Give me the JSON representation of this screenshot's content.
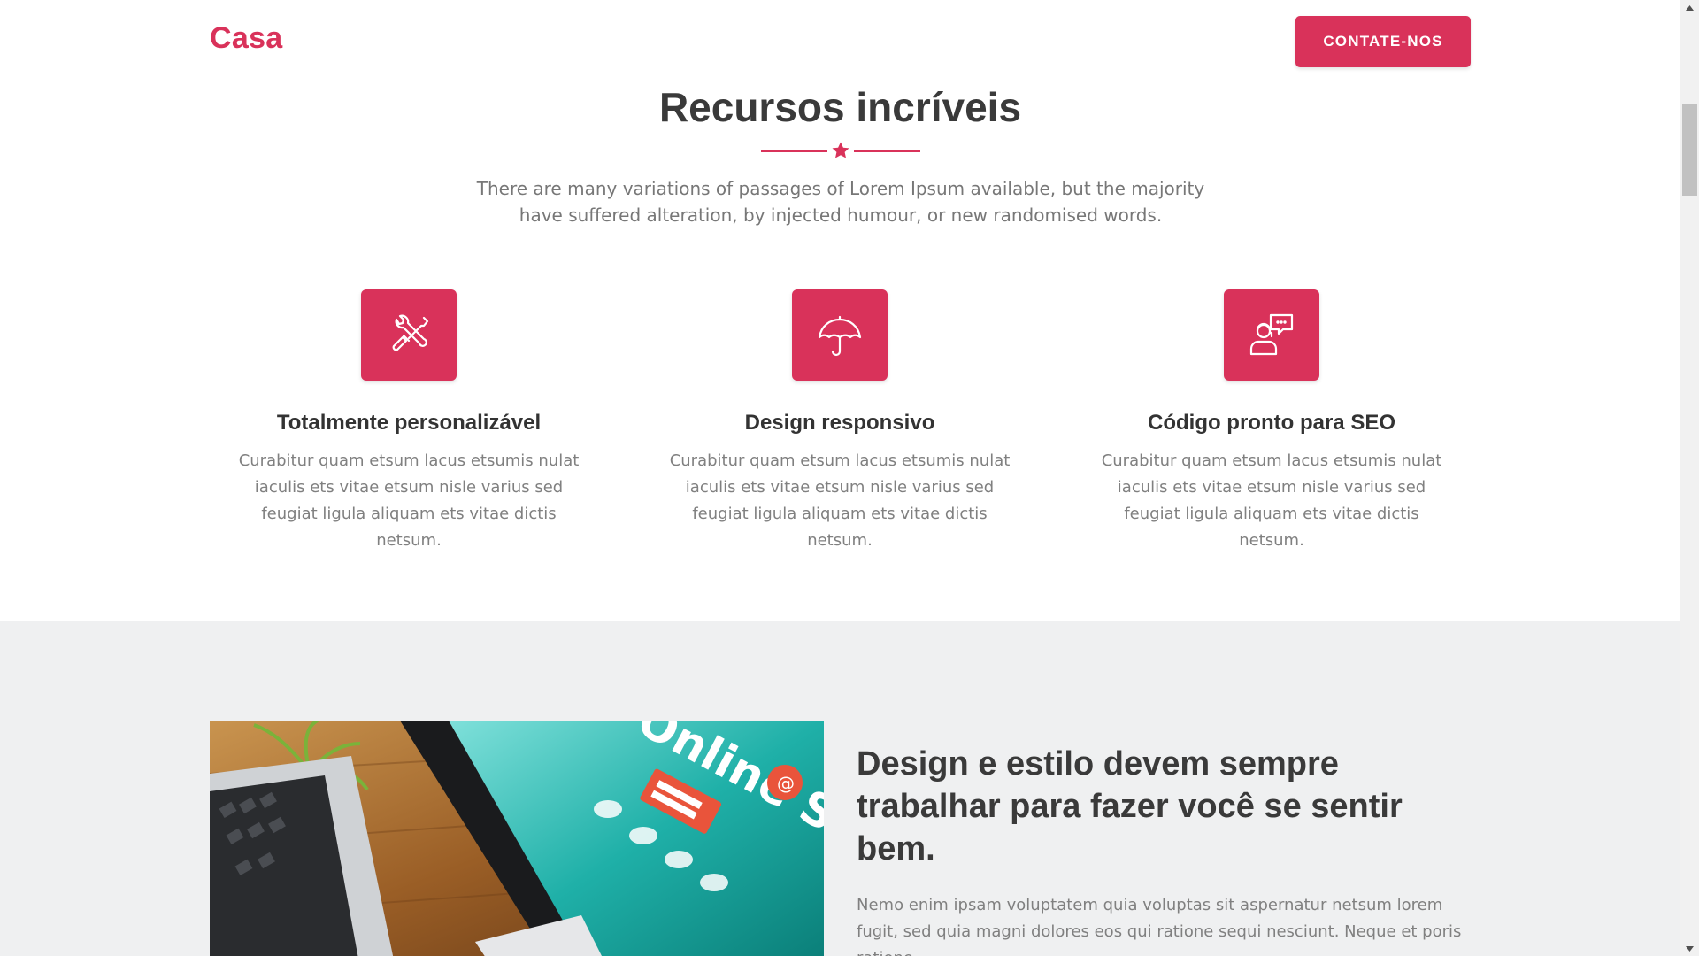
{
  "header": {
    "logo": "Casa",
    "cta_label": "CONTATE-NOS"
  },
  "features": {
    "title": "Recursos incríveis",
    "description": "There are many variations of passages of Lorem Ipsum available, but the majority have suffered alteration, by injected humour, or new randomised words.",
    "items": [
      {
        "icon": "tools-icon",
        "title": "Totalmente personalizável",
        "text": "Curabitur quam etsum lacus etsumis nulat iaculis ets vitae etsum nisle varius sed feugiat ligula aliquam ets vitae dictis netsum."
      },
      {
        "icon": "umbrella-icon",
        "title": "Design responsivo",
        "text": "Curabitur quam etsum lacus etsumis nulat iaculis ets vitae etsum nisle varius sed feugiat ligula aliquam ets vitae dictis netsum."
      },
      {
        "icon": "support-chat-icon",
        "title": "Código pronto para SEO",
        "text": "Curabitur quam etsum lacus etsumis nulat iaculis ets vitae etsum nisle varius sed feugiat ligula aliquam ets vitae dictis netsum."
      }
    ]
  },
  "about": {
    "image_text": "Online Shopping",
    "title": "Design e estilo devem sempre trabalhar para fazer você se sentir bem.",
    "text": "Nemo enim ipsam voluptatem quia voluptas sit aspernatur netsum lorem fugit, sed quia magni dolores eos qui ratione sequi nesciunt. Neque et poris ratione"
  },
  "colors": {
    "accent": "#d9325a",
    "heading": "#3a3a3a",
    "body_text": "#808080",
    "section_bg": "#eff0f1"
  }
}
